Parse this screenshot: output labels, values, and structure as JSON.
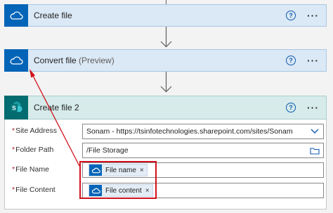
{
  "card1": {
    "title": "Create file",
    "app": "onedrive",
    "help_glyph": "?",
    "more_glyph": "···"
  },
  "card2": {
    "title": "Convert file",
    "title_suffix": "(Preview)",
    "app": "onedrive",
    "help_glyph": "?",
    "more_glyph": "···"
  },
  "card3": {
    "title": "Create file 2",
    "app": "sharepoint",
    "help_glyph": "?",
    "more_glyph": "···",
    "fields": {
      "site_address": {
        "label": "Site Address",
        "value": "Sonam - https://tsinfotechnologies.sharepoint.com/sites/Sonam"
      },
      "folder_path": {
        "label": "Folder Path",
        "value": "/File Storage"
      },
      "file_name": {
        "label": "File Name",
        "token": "File name",
        "remove": "×"
      },
      "file_content": {
        "label": "File Content",
        "token": "File content",
        "remove": "×"
      }
    },
    "required_mark": "*"
  },
  "colors": {
    "onedrive_blue": "#0364b8",
    "sharepoint_teal": "#036c70",
    "annotation_red": "#d1121d"
  }
}
